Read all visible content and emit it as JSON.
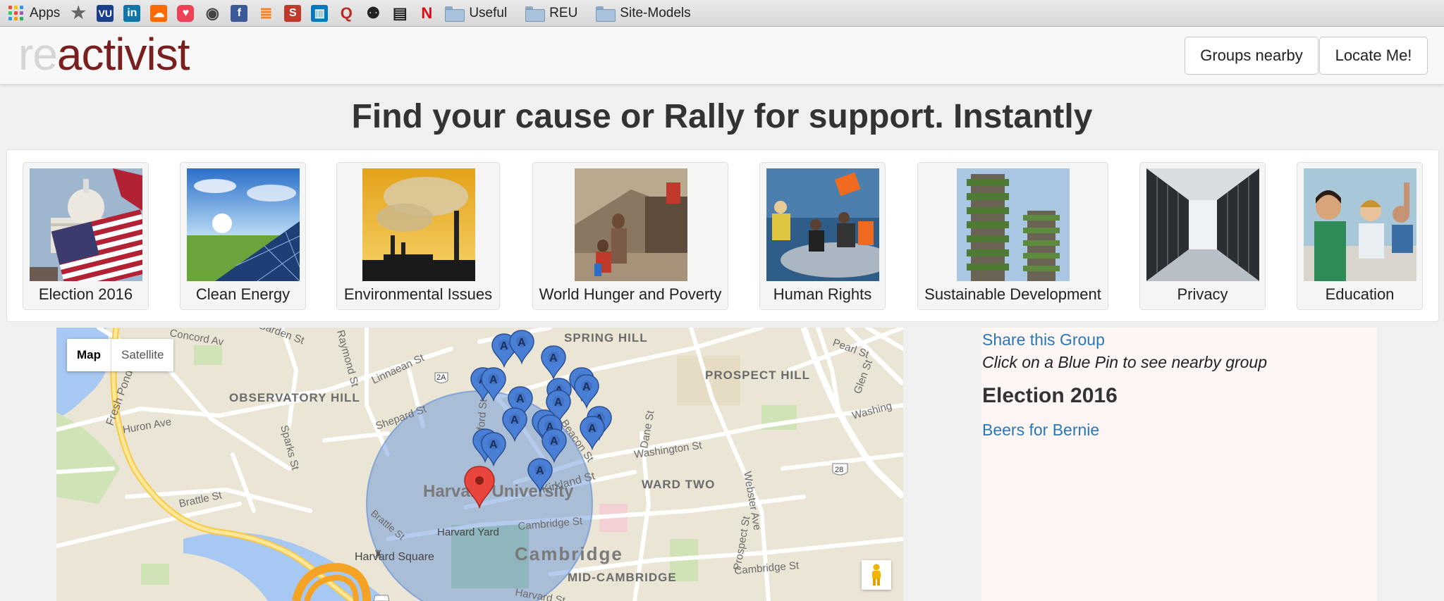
{
  "bookmarks": {
    "items": [
      {
        "label": "Apps",
        "icon": "apps-grid-icon"
      },
      {
        "label": "",
        "icon": "star-icon"
      },
      {
        "label": "",
        "icon": "vu-icon",
        "glyph": "VU"
      },
      {
        "label": "",
        "icon": "linkedin-icon",
        "glyph": "in"
      },
      {
        "label": "",
        "icon": "soundcloud-icon",
        "glyph": "☁"
      },
      {
        "label": "",
        "icon": "pocket-icon",
        "glyph": "♥"
      },
      {
        "label": "",
        "icon": "reddit-icon",
        "glyph": "◉"
      },
      {
        "label": "",
        "icon": "facebook-icon",
        "glyph": "f"
      },
      {
        "label": "",
        "icon": "stackoverflow-icon",
        "glyph": "≣"
      },
      {
        "label": "",
        "icon": "s-icon",
        "glyph": "S"
      },
      {
        "label": "",
        "icon": "trello-icon",
        "glyph": "▥"
      },
      {
        "label": "",
        "icon": "quora-icon",
        "glyph": "Q"
      },
      {
        "label": "",
        "icon": "people-icon",
        "glyph": "⚉"
      },
      {
        "label": "",
        "icon": "terminal-icon",
        "glyph": "▤"
      },
      {
        "label": "",
        "icon": "netflix-icon",
        "glyph": "N"
      }
    ],
    "folders": [
      "Useful",
      "REU",
      "Site-Models"
    ]
  },
  "navbar": {
    "brand_prefix": "re",
    "brand_suffix": "activist",
    "groups_nearby": "Groups nearby",
    "locate_me": "Locate Me!"
  },
  "headline": "Find your cause or Rally for support. Instantly",
  "causes": [
    {
      "label": "Election 2016"
    },
    {
      "label": "Clean Energy"
    },
    {
      "label": "Environmental Issues"
    },
    {
      "label": "World Hunger and Poverty"
    },
    {
      "label": "Human Rights"
    },
    {
      "label": "Sustainable Development"
    },
    {
      "label": "Privacy"
    },
    {
      "label": "Education"
    }
  ],
  "map": {
    "toggle_map": "Map",
    "toggle_satellite": "Satellite",
    "labels": {
      "spring_hill": "SPRING HILL",
      "prospect_hill": "PROSPECT HILL",
      "observatory_hill": "OBSERVATORY HILL",
      "ward_two": "WARD TWO",
      "mid_cambridge": "MID-CAMBRIDGE",
      "cambridge": "Cambridge",
      "harvard_university": "Harvard University",
      "harvard_yard": "Harvard Yard",
      "harvard_square": "Harvard Square",
      "linnaean": "Linnaean St",
      "shepard": "Shepard St",
      "huron": "Huron Ave",
      "brattle": "Brattle St",
      "brattle2": "Brattle St",
      "concord": "Concord Av",
      "garden": "Garden St",
      "raymond": "Raymond St",
      "sparks": "Sparks St",
      "fresh_pond": "Fresh Pond Pkwy",
      "washington": "Washington St",
      "washington2": "Washing",
      "kirkland": "Kirkland St",
      "cambridge_st": "Cambridge St",
      "cambridge_st2": "Cambridge St",
      "oxford": "Oxford St",
      "beacon": "Beacon St",
      "dane": "Dane St",
      "webster": "Webster Ave",
      "prospect": "Prospect St",
      "pearl": "Pearl St",
      "glen": "Glen St",
      "harvard_st": "Harvard St",
      "route_2a": "2A",
      "route_28": "28"
    }
  },
  "panel": {
    "share_link": "Share this Group",
    "hint": "Click on a Blue Pin to see nearby group",
    "title": "Election 2016",
    "group_link": "Beers for Bernie"
  }
}
